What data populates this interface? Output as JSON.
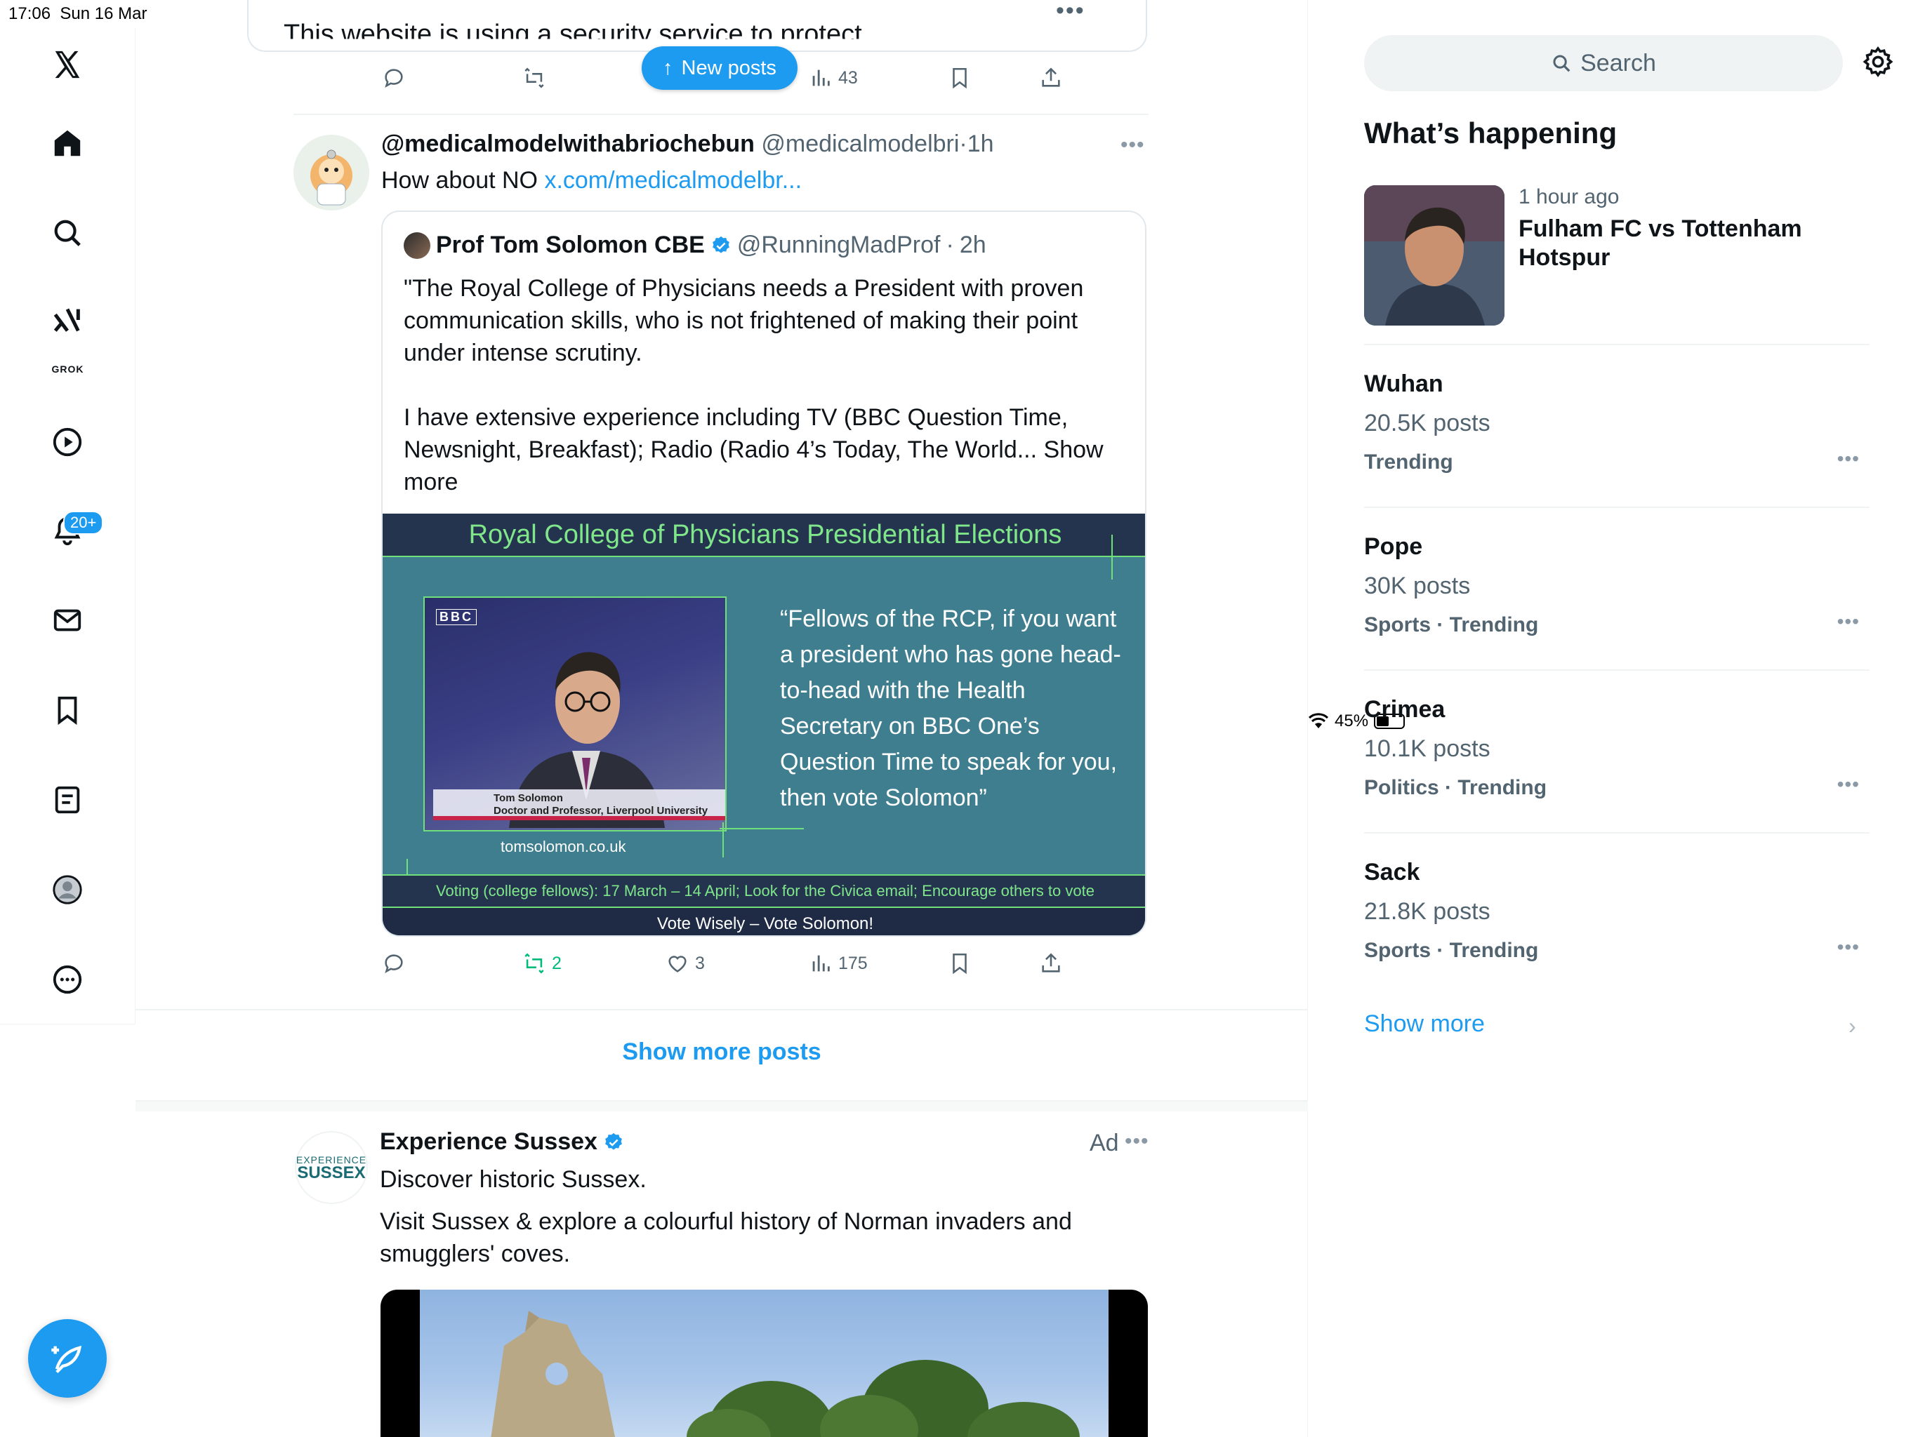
{
  "status_bar": {
    "time": "17:06",
    "date": "Sun 16 Mar",
    "battery": "45%",
    "battery_level": 0.45
  },
  "left_nav": {
    "items": [
      {
        "icon": "x-logo-icon"
      },
      {
        "icon": "home-icon"
      },
      {
        "icon": "search-icon"
      },
      {
        "icon": "grok-icon",
        "label": "GROK"
      },
      {
        "icon": "video-icon"
      },
      {
        "icon": "notifications-icon",
        "badge": "20+"
      },
      {
        "icon": "messages-icon"
      },
      {
        "icon": "bookmarks-icon"
      },
      {
        "icon": "lists-icon"
      },
      {
        "icon": "profile-icon"
      },
      {
        "icon": "more-icon"
      }
    ],
    "compose_icon": "compose-icon"
  },
  "feed": {
    "previous_post": {
      "text": "This website is using a security service to protect",
      "views": "43"
    },
    "new_posts_label": "New posts",
    "post": {
      "display_name": "@medicalmodelwithabriochebun",
      "handle": "@medicalmodelbri",
      "time": "1h",
      "text_prefix": "How about NO ",
      "link": "x.com/medicalmodelbr...",
      "quote": {
        "display_name": "Prof Tom Solomon CBE",
        "handle": "@RunningMadProf",
        "time": "2h",
        "text_p1": "\"The Royal College of Physicians needs a President with proven communication skills, who is not frightened of making their point under intense scrutiny.",
        "text_p2": "I have extensive  experience including TV (BBC Question Time, Newsnight, Breakfast); Radio (Radio 4’s Today, The World...",
        "show_more": "Show more",
        "poster": {
          "title": "Royal College of Physicians Presidential Elections",
          "bbc": "BBC",
          "caption_name": "Tom Solomon",
          "caption_role": "Doctor and Professor, Liverpool University",
          "site": "tomsolomon.co.uk",
          "quote": "“Fellows of the RCP, if you want a president who has gone head-to-head with the Health Secretary on BBC One’s Question Time to speak for you, then vote Solomon”",
          "voting_line": "Voting (college fellows): 17 March – 14 April; Look for the Civica email; Encourage others to vote",
          "slogan": "Vote Wisely – Vote Solomon!"
        }
      },
      "stats": {
        "reposts": "2",
        "likes": "3",
        "views": "175"
      }
    },
    "show_more_posts": "Show more posts",
    "ad": {
      "avatar_line1": "EXPERIENCE",
      "avatar_line2": "SUSSEX",
      "display_name": "Experience Sussex",
      "ad_label": "Ad",
      "text1": "Discover historic Sussex.",
      "text2": "Visit Sussex & explore a colourful history of Norman invaders and smugglers' coves."
    }
  },
  "sidebar": {
    "search_placeholder": "Search",
    "whats_happening": "What’s happening",
    "news": {
      "time": "1 hour ago",
      "title": "Fulham FC vs Tottenham Hotspur"
    },
    "trends": [
      {
        "name": "Wuhan",
        "count": "20.5K posts",
        "meta": "Trending"
      },
      {
        "name": "Pope",
        "count": "30K posts",
        "meta": "Sports · Trending"
      },
      {
        "name": "Crimea",
        "count": "10.1K posts",
        "meta": "Politics · Trending"
      },
      {
        "name": "Sack",
        "count": "21.8K posts",
        "meta": "Sports · Trending"
      }
    ],
    "show_more": "Show more"
  },
  "colors": {
    "accent": "#1d9bf0",
    "text": "#0f1419",
    "muted": "#536471",
    "repost_green": "#00ba7c",
    "poster_teal": "#3f7e8f",
    "poster_navy": "#24344f",
    "poster_green": "#7fe68a"
  }
}
